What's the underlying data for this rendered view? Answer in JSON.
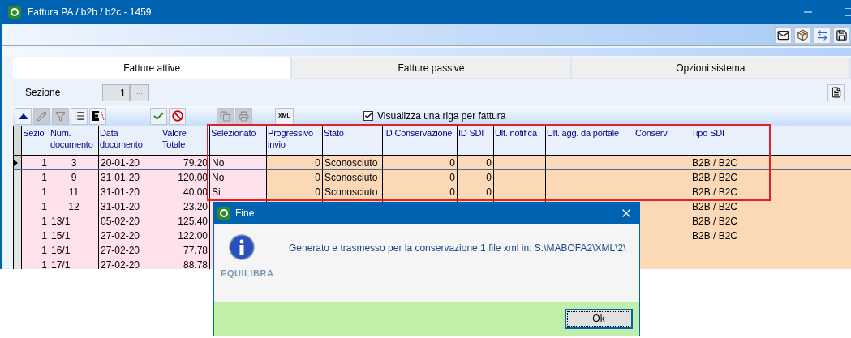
{
  "window": {
    "title": "Fattura PA / b2b / b2c - 1459"
  },
  "tabs": [
    {
      "label": "Fatture attive",
      "selected": true
    },
    {
      "label": "Fatture passive",
      "selected": false
    },
    {
      "label": "Opzioni sistema",
      "selected": false
    }
  ],
  "sezione": {
    "label": "Sezione",
    "value": "1",
    "browse": "..."
  },
  "toolbar": {
    "xml": "XML",
    "checkbox": {
      "label": "Visualizza una riga per fattura",
      "checked": true
    }
  },
  "table": {
    "columns": [
      "Sezio",
      "Num. documento",
      "Data documento",
      "Valore Totale",
      "Selezionato",
      "Progressivo invio",
      "Stato",
      "ID Conservazione",
      "ID SDI",
      "Ult. notifica",
      "Ult. agg. da portale",
      "Conserv",
      "Tipo SDI"
    ],
    "rows": [
      {
        "selected": true,
        "num_centered": true,
        "sezione": "1",
        "num": "3",
        "data": "20-01-20",
        "valore": "79.20",
        "selezionato": "No",
        "progressivo": "0",
        "stato": "Sconosciuto",
        "id_conservazione": "0",
        "id_sdi": "0",
        "tipo_sdi": "B2B / B2C"
      },
      {
        "selected": false,
        "num_centered": true,
        "sezione": "1",
        "num": "9",
        "data": "31-01-20",
        "valore": "120.00",
        "selezionato": "No",
        "progressivo": "0",
        "stato": "Sconosciuto",
        "id_conservazione": "0",
        "id_sdi": "0",
        "tipo_sdi": "B2B / B2C"
      },
      {
        "selected": false,
        "num_centered": true,
        "sezione": "1",
        "num": "11",
        "data": "31-01-20",
        "valore": "40.00",
        "selezionato": "Si",
        "progressivo": "0",
        "stato": "Sconosciuto",
        "id_conservazione": "0",
        "id_sdi": "0",
        "tipo_sdi": "B2B / B2C"
      },
      {
        "selected": false,
        "num_centered": true,
        "sezione": "1",
        "num": "12",
        "data": "31-01-20",
        "valore": "23.20",
        "tipo_sdi": "B2B / B2C"
      },
      {
        "selected": false,
        "num_centered": false,
        "sezione": "1",
        "num": "13/1",
        "data": "05-02-20",
        "valore": "125.40",
        "tipo_sdi": "B2B / B2C"
      },
      {
        "selected": false,
        "num_centered": false,
        "sezione": "1",
        "num": "15/1",
        "data": "27-02-20",
        "valore": "122.00",
        "tipo_sdi": "B2B / B2C"
      },
      {
        "selected": false,
        "num_centered": false,
        "sezione": "1",
        "num": "16/1",
        "data": "27-02-20",
        "valore": "77.78"
      },
      {
        "selected": false,
        "num_centered": false,
        "sezione": "1",
        "num": "17/1",
        "data": "27-02-20",
        "valore": "88.78"
      }
    ]
  },
  "dialog": {
    "title": "Fine",
    "message": "Generato e trasmesso per la conservazione 1 file xml in: S:\\MABOFA2\\XML\\2\\",
    "logo": "EQUILIBRA",
    "button": "Ok"
  }
}
